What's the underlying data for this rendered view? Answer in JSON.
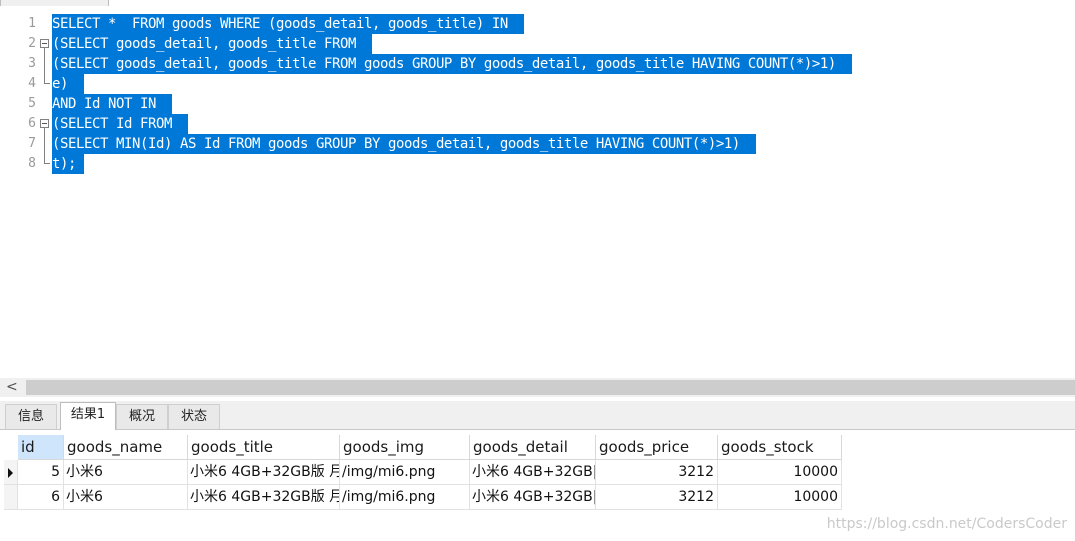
{
  "editor": {
    "lines": [
      {
        "num": "1",
        "text": "SELECT *  FROM goods WHERE (goods_detail, goods_title) IN "
      },
      {
        "num": "2",
        "text": "(SELECT goods_detail, goods_title FROM "
      },
      {
        "num": "3",
        "text": "(SELECT goods_detail, goods_title FROM goods GROUP BY goods_detail, goods_title HAVING COUNT(*)>1) "
      },
      {
        "num": "4",
        "text": "e) "
      },
      {
        "num": "5",
        "text": "AND Id NOT IN "
      },
      {
        "num": "6",
        "text": "(SELECT Id FROM "
      },
      {
        "num": "7",
        "text": "(SELECT MIN(Id) AS Id FROM goods GROUP BY goods_detail, goods_title HAVING COUNT(*)>1) "
      },
      {
        "num": "8",
        "text": "t);"
      }
    ],
    "selection_color": "#0078d7"
  },
  "scrollbar": {
    "left_arrow": "<"
  },
  "result_tabs": [
    {
      "label": "信息"
    },
    {
      "label": "结果1"
    },
    {
      "label": "概况"
    },
    {
      "label": "状态"
    }
  ],
  "grid": {
    "columns": [
      "id",
      "goods_name",
      "goods_title",
      "goods_img",
      "goods_detail",
      "goods_price",
      "goods_stock"
    ],
    "rows": [
      [
        "5",
        "小米6",
        "小米6 4GB+32GB版 月",
        "/img/mi6.png",
        "小米6 4GB+32GB|",
        "3212",
        "10000"
      ],
      [
        "6",
        "小米6",
        "小米6 4GB+32GB版 月",
        "/img/mi6.png",
        "小米6 4GB+32GB|",
        "3212",
        "10000"
      ]
    ]
  },
  "watermark": "https://blog.csdn.net/CodersCoder"
}
